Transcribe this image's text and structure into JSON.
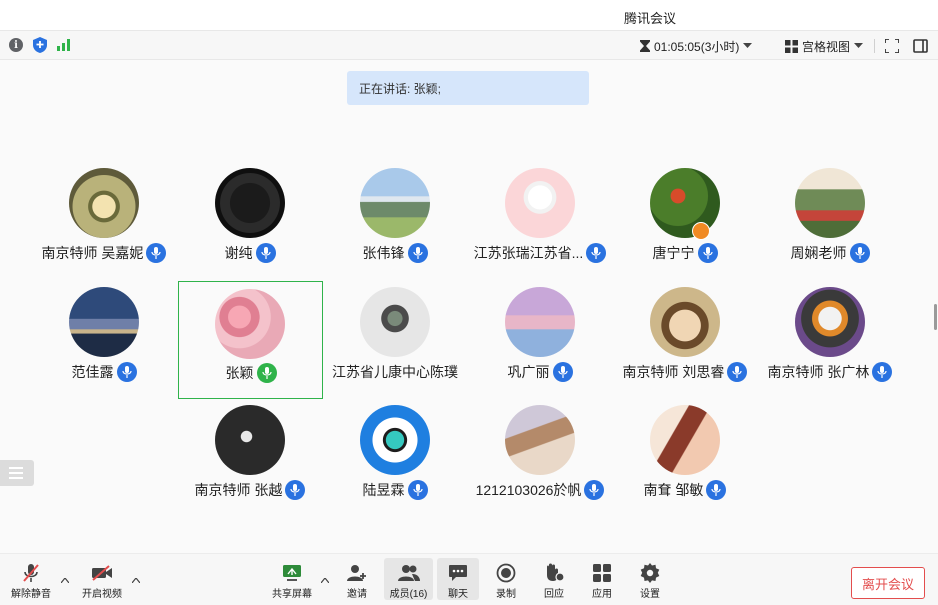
{
  "window": {
    "title": "腾讯会议"
  },
  "topbar": {
    "duration": "01:05:05(3小时)",
    "view_label": "宫格视图",
    "icons": [
      "info-icon",
      "shield-icon",
      "signal-icon",
      "hourglass-icon",
      "grid-icon",
      "fullscreen-icon",
      "side-panel-icon"
    ]
  },
  "speaking": {
    "text": "正在讲话: 张颖;"
  },
  "participants": [
    {
      "name": "南京特师 吴嘉妮",
      "mic": "blue"
    },
    {
      "name": "谢纯",
      "mic": "blue"
    },
    {
      "name": "张伟锋",
      "mic": "blue"
    },
    {
      "name": "江苏张瑞江苏省...",
      "mic": "blue"
    },
    {
      "name": "唐宁宁",
      "mic": "blue",
      "host": true
    },
    {
      "name": "周娴老师",
      "mic": "blue"
    },
    {
      "name": "范佳露",
      "mic": "blue"
    },
    {
      "name": "张颖",
      "mic": "green",
      "active": true
    },
    {
      "name": "江苏省儿康中心陈璞",
      "mic": "none"
    },
    {
      "name": "巩广丽",
      "mic": "blue"
    },
    {
      "name": "南京特师 刘思睿",
      "mic": "blue"
    },
    {
      "name": "南京特师 张广林",
      "mic": "blue"
    },
    {
      "name": "南京特师 张越",
      "mic": "blue"
    },
    {
      "name": "陆昱霖",
      "mic": "blue"
    },
    {
      "name": "1212103026於帆",
      "mic": "blue"
    },
    {
      "name": "南耷 邹敏",
      "mic": "blue"
    }
  ],
  "toolbar": {
    "unmute": "解除静音",
    "start_video": "开启视频",
    "share_screen": "共享屏幕",
    "invite": "邀请",
    "members": "成员(16)",
    "chat": "聊天",
    "record": "录制",
    "reactions": "回应",
    "apps": "应用",
    "settings": "设置",
    "leave": "离开会议"
  },
  "colors": {
    "accent": "#2a72e0",
    "active_border": "#2fb34a",
    "danger": "#e34d4d",
    "speaking_bg": "#d6e6fb"
  }
}
